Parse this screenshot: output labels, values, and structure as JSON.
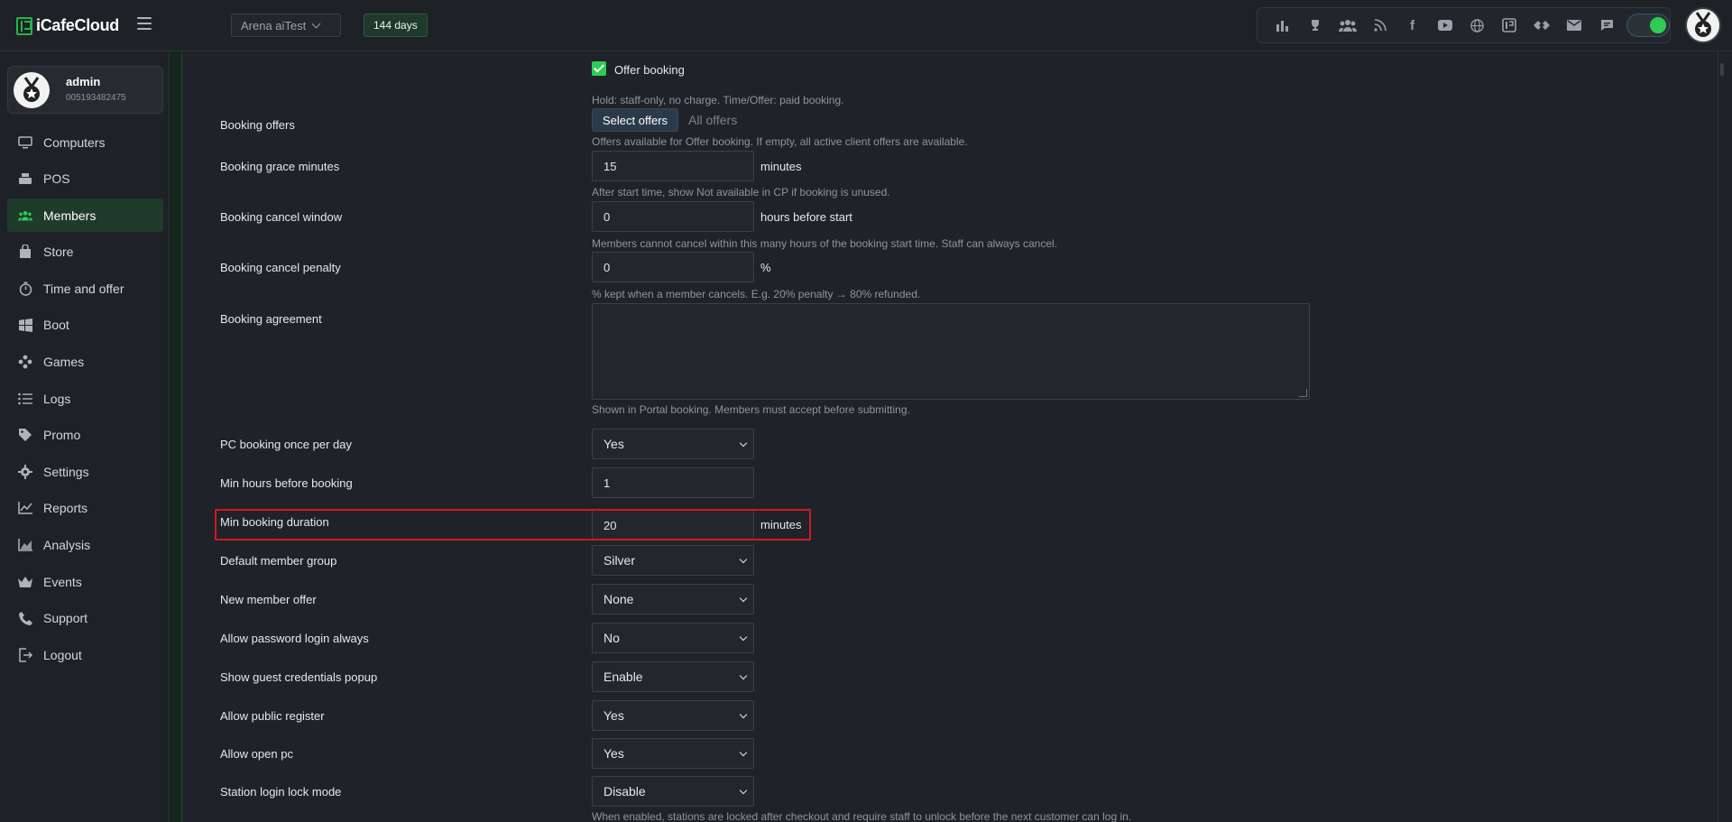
{
  "app": {
    "name": "iCafeCloud"
  },
  "header": {
    "shop_name": "Arena aiTest",
    "days_left": "144 days",
    "toolbar_icons": [
      "leaderboard-icon",
      "trophy-icon",
      "users-icon",
      "rss-icon",
      "facebook-icon",
      "youtube-icon",
      "globe-icon",
      "icafe-icon",
      "tool-icon",
      "mail-icon",
      "chat-icon"
    ]
  },
  "user": {
    "name": "admin",
    "id": "005193482475"
  },
  "sidebar": {
    "items": [
      {
        "label": "Computers",
        "icon": "monitor-icon",
        "active": false
      },
      {
        "label": "POS",
        "icon": "pos-icon",
        "active": false
      },
      {
        "label": "Members",
        "icon": "members-icon",
        "active": true
      },
      {
        "label": "Store",
        "icon": "store-icon",
        "active": false
      },
      {
        "label": "Time and offer",
        "icon": "timer-icon",
        "active": false
      },
      {
        "label": "Boot",
        "icon": "boot-icon",
        "active": false
      },
      {
        "label": "Games",
        "icon": "gamepad-icon",
        "active": false
      },
      {
        "label": "Logs",
        "icon": "logs-icon",
        "active": false
      },
      {
        "label": "Promo",
        "icon": "tag-icon",
        "active": false
      },
      {
        "label": "Settings",
        "icon": "gear-icon",
        "active": false
      },
      {
        "label": "Reports",
        "icon": "chart-line-icon",
        "active": false
      },
      {
        "label": "Analysis",
        "icon": "chart-area-icon",
        "active": false
      },
      {
        "label": "Events",
        "icon": "crown-icon",
        "active": false
      },
      {
        "label": "Support",
        "icon": "phone-icon",
        "active": false
      },
      {
        "label": "Logout",
        "icon": "logout-icon",
        "active": false
      }
    ]
  },
  "form": {
    "offer_booking": {
      "label": "Offer booking",
      "checked": true
    },
    "offer_booking_help": "Hold: staff-only, no charge. Time/Offer: paid booking.",
    "booking_offers": {
      "label": "Booking offers",
      "button": "Select offers",
      "value": "All offers",
      "help": "Offers available for Offer booking. If empty, all active client offers are available."
    },
    "grace_minutes": {
      "label": "Booking grace minutes",
      "value": "15",
      "unit": "minutes",
      "help": "After start time, show Not available in CP if booking is unused."
    },
    "cancel_window": {
      "label": "Booking cancel window",
      "value": "0",
      "unit": "hours before start",
      "help": "Members cannot cancel within this many hours of the booking start time. Staff can always cancel."
    },
    "cancel_penalty": {
      "label": "Booking cancel penalty",
      "value": "0",
      "unit": "%",
      "help": "% kept when a member cancels. E.g. 20% penalty → 80% refunded."
    },
    "agreement": {
      "label": "Booking agreement",
      "value": "",
      "help": "Shown in Portal booking. Members must accept before submitting."
    },
    "pc_once_per_day": {
      "label": "PC booking once per day",
      "value": "Yes"
    },
    "min_hours_before": {
      "label": "Min hours before booking",
      "value": "1"
    },
    "min_duration": {
      "label": "Min booking duration",
      "value": "20",
      "unit": "minutes"
    },
    "default_group": {
      "label": "Default member group",
      "value": "Silver"
    },
    "new_member_offer": {
      "label": "New member offer",
      "value": "None"
    },
    "password_login": {
      "label": "Allow password login always",
      "value": "No"
    },
    "guest_popup": {
      "label": "Show guest credentials popup",
      "value": "Enable"
    },
    "public_register": {
      "label": "Allow public register",
      "value": "Yes"
    },
    "open_pc": {
      "label": "Allow open pc",
      "value": "Yes"
    },
    "station_lock": {
      "label": "Station login lock mode",
      "value": "Disable",
      "help": "When enabled, stations are locked after checkout and require staff to unlock before the next customer can log in."
    }
  },
  "colors": {
    "accent": "#2ecc55",
    "highlight": "#d0191f",
    "background": "#1f2329"
  }
}
